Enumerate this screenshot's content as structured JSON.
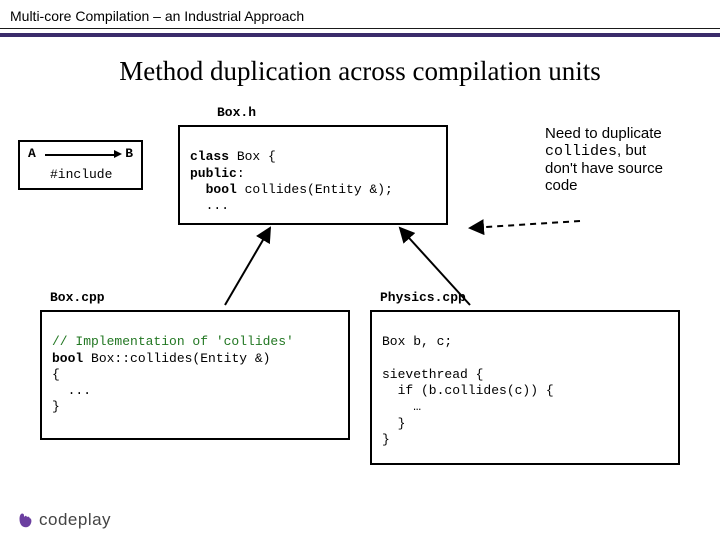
{
  "header": "Multi-core Compilation – an Industrial Approach",
  "title": "Method duplication across compilation units",
  "labels": {
    "box_h": "Box.h",
    "box_cpp": "Box.cpp",
    "physics_cpp": "Physics.cpp"
  },
  "include_diag": {
    "A": "A",
    "B": "B",
    "include": "#include"
  },
  "code": {
    "box_h": "class Box {\npublic:\n  bool collides(Entity &);\n  ...\n",
    "box_cpp_comment": "// Implementation of 'collides'",
    "box_cpp_body": "bool Box::collides(Entity &)\n{\n  ...\n}",
    "physics_cpp": "Box b, c;\n\nsievethread {\n  if (b.collides(c)) {\n    …\n  }\n}"
  },
  "note": {
    "line1a": "Need to duplicate",
    "line1b_code": "collides",
    "line1b_rest": ", but",
    "line2": "don't have source",
    "line3": "code"
  },
  "logo_text": "codeplay"
}
